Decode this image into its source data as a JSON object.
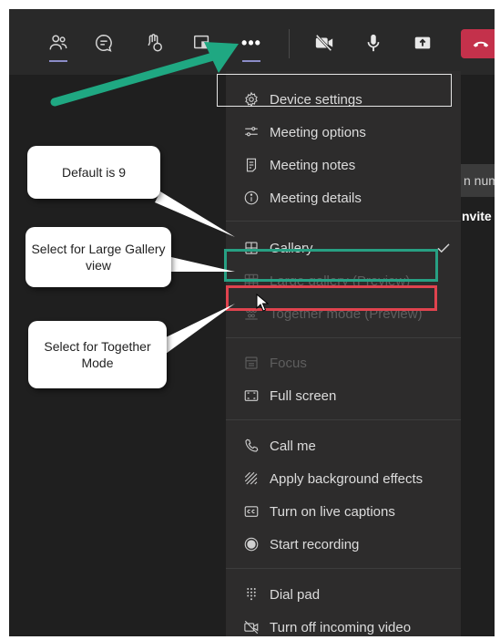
{
  "toolbar": {
    "buttons": [
      {
        "name": "people",
        "icon": "people-icon"
      },
      {
        "name": "chat",
        "icon": "chat-icon"
      },
      {
        "name": "reactions",
        "icon": "raise-hand-icon"
      },
      {
        "name": "rooms",
        "icon": "rooms-icon"
      },
      {
        "name": "more-actions",
        "icon": "ellipsis-icon",
        "label": "•••"
      },
      {
        "name": "camera",
        "icon": "camera-off-icon"
      },
      {
        "name": "mic",
        "icon": "microphone-icon"
      },
      {
        "name": "share",
        "icon": "share-tray-icon"
      },
      {
        "name": "leave",
        "icon": "hang-up-icon"
      }
    ]
  },
  "side_panel": {
    "number_text": "n numb",
    "invite_text": "nvite"
  },
  "menu": {
    "items": [
      {
        "label": "Device settings",
        "icon": "gear-icon",
        "disabled": false
      },
      {
        "label": "Meeting options",
        "icon": "sliders-icon",
        "disabled": false
      },
      {
        "label": "Meeting notes",
        "icon": "notes-icon",
        "disabled": false
      },
      {
        "label": "Meeting details",
        "icon": "info-icon",
        "disabled": false
      },
      {
        "label": "Gallery",
        "icon": "grid-icon",
        "disabled": false,
        "checked": true
      },
      {
        "label": "Large gallery (Preview)",
        "icon": "large-grid-icon",
        "disabled": true
      },
      {
        "label": "Together mode (Preview)",
        "icon": "together-mode-icon",
        "disabled": true
      },
      {
        "label": "Focus",
        "icon": "focus-icon",
        "disabled": true
      },
      {
        "label": "Full screen",
        "icon": "fullscreen-icon",
        "disabled": false
      },
      {
        "label": "Call me",
        "icon": "phone-icon",
        "disabled": false
      },
      {
        "label": "Apply background effects",
        "icon": "background-effects-icon",
        "disabled": false
      },
      {
        "label": "Turn on live captions",
        "icon": "captions-icon",
        "disabled": false
      },
      {
        "label": "Start recording",
        "icon": "record-icon",
        "disabled": false
      },
      {
        "label": "Dial pad",
        "icon": "dialpad-icon",
        "disabled": false
      },
      {
        "label": "Turn off incoming video",
        "icon": "video-off-icon",
        "disabled": false
      }
    ]
  },
  "callouts": {
    "default": "Default is 9",
    "large_gallery": "Select for Large Gallery view",
    "together": "Select for Together Mode"
  },
  "colors": {
    "arrow": "#1fa882",
    "green_box": "#27a083",
    "red_box": "#e0434e",
    "leave": "#c4314b",
    "accent_underline": "#8b8cc7"
  }
}
